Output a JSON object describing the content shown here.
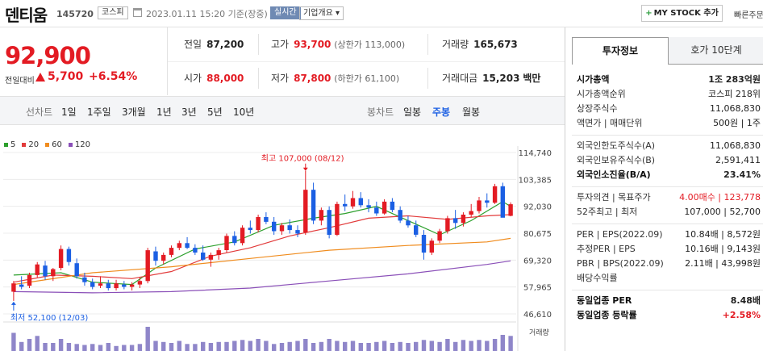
{
  "header": {
    "stock_name": "덴티움",
    "stock_code": "145720",
    "market": "코스피",
    "datetime": "2023.01.11 15:20 기준(장중)",
    "realtime_label": "실시간",
    "company_overview_label": "기업개요 ▾",
    "mystock_label": "MY STOCK 추가",
    "quick_order_label": "빠른주문"
  },
  "price": {
    "current": "92,900",
    "change_label": "전일대비",
    "change_value": "5,700",
    "change_pct": "+6.54%"
  },
  "summary": {
    "prev_close_label": "전일",
    "prev_close": "87,200",
    "high_label": "고가",
    "high": "93,700",
    "upper_limit": "(상한가 113,000)",
    "volume_label": "거래량",
    "volume": "165,673",
    "open_label": "시가",
    "open": "88,000",
    "low_label": "저가",
    "low": "87,800",
    "lower_limit": "(하한가 61,100)",
    "amount_label": "거래대금",
    "amount": "15,203",
    "amount_unit": "백만"
  },
  "period_bar": {
    "line_label": "선차트",
    "line_items": [
      "1일",
      "1주일",
      "3개월",
      "1년",
      "3년",
      "5년",
      "10년"
    ],
    "candle_label": "봉차트",
    "candle_items": [
      "일봉",
      "주봉",
      "월봉"
    ],
    "active_candle": "주봉"
  },
  "chart_data": {
    "type": "candlestick",
    "legend": [
      {
        "name": "5",
        "color": "#2da02d"
      },
      {
        "name": "20",
        "color": "#e23b3b"
      },
      {
        "name": "60",
        "color": "#f08c1e"
      },
      {
        "name": "120",
        "color": "#8a4fb8"
      }
    ],
    "y_ticks": [
      "114,740",
      "103,385",
      "92,030",
      "80,675",
      "69,320",
      "57,965",
      "46,610"
    ],
    "ylim": [
      46610,
      114740
    ],
    "max_annotation": "최고 107,000 (08/12)",
    "min_annotation": "최저 52,100 (12/03)",
    "volume_label": "거래량",
    "up_color": "#e31b23",
    "down_color": "#1b5fe3",
    "candles": [
      {
        "o": 56000,
        "h": 60500,
        "l": 52100,
        "c": 59500
      },
      {
        "o": 59000,
        "h": 62500,
        "l": 57000,
        "c": 58000
      },
      {
        "o": 58500,
        "h": 64000,
        "l": 57500,
        "c": 63000
      },
      {
        "o": 63000,
        "h": 68500,
        "l": 62000,
        "c": 67500
      },
      {
        "o": 67000,
        "h": 69000,
        "l": 61000,
        "c": 62500
      },
      {
        "o": 62500,
        "h": 66000,
        "l": 60500,
        "c": 65500
      },
      {
        "o": 66000,
        "h": 75500,
        "l": 65000,
        "c": 74000
      },
      {
        "o": 74000,
        "h": 75000,
        "l": 67000,
        "c": 68500
      },
      {
        "o": 68000,
        "h": 70000,
        "l": 61500,
        "c": 62500
      },
      {
        "o": 62000,
        "h": 64000,
        "l": 58500,
        "c": 60000
      },
      {
        "o": 60000,
        "h": 61500,
        "l": 57000,
        "c": 58000
      },
      {
        "o": 58500,
        "h": 62500,
        "l": 57500,
        "c": 59500
      },
      {
        "o": 59500,
        "h": 61000,
        "l": 56500,
        "c": 57500
      },
      {
        "o": 57500,
        "h": 61000,
        "l": 56500,
        "c": 59500
      },
      {
        "o": 59000,
        "h": 60500,
        "l": 57000,
        "c": 58000
      },
      {
        "o": 58000,
        "h": 60000,
        "l": 56500,
        "c": 59000
      },
      {
        "o": 59000,
        "h": 62000,
        "l": 57500,
        "c": 60500
      },
      {
        "o": 60500,
        "h": 74500,
        "l": 59500,
        "c": 73500
      },
      {
        "o": 73000,
        "h": 75000,
        "l": 67000,
        "c": 69000
      },
      {
        "o": 69000,
        "h": 72500,
        "l": 67500,
        "c": 71500
      },
      {
        "o": 71500,
        "h": 75500,
        "l": 70500,
        "c": 74500
      },
      {
        "o": 74500,
        "h": 77500,
        "l": 73500,
        "c": 76500
      },
      {
        "o": 76500,
        "h": 79000,
        "l": 74000,
        "c": 74500
      },
      {
        "o": 74500,
        "h": 76000,
        "l": 71500,
        "c": 72500
      },
      {
        "o": 72500,
        "h": 75500,
        "l": 69000,
        "c": 69500
      },
      {
        "o": 69500,
        "h": 72500,
        "l": 66500,
        "c": 71500
      },
      {
        "o": 71500,
        "h": 74500,
        "l": 69500,
        "c": 73500
      },
      {
        "o": 73500,
        "h": 80500,
        "l": 72500,
        "c": 79500
      },
      {
        "o": 79500,
        "h": 81500,
        "l": 75500,
        "c": 76500
      },
      {
        "o": 76500,
        "h": 84000,
        "l": 75500,
        "c": 83000
      },
      {
        "o": 83000,
        "h": 86000,
        "l": 80500,
        "c": 82000
      },
      {
        "o": 82000,
        "h": 88500,
        "l": 81000,
        "c": 87500
      },
      {
        "o": 87500,
        "h": 89500,
        "l": 84500,
        "c": 85500
      },
      {
        "o": 85500,
        "h": 87500,
        "l": 80000,
        "c": 81500
      },
      {
        "o": 81500,
        "h": 85000,
        "l": 80000,
        "c": 84000
      },
      {
        "o": 84000,
        "h": 86500,
        "l": 80500,
        "c": 82000
      },
      {
        "o": 82000,
        "h": 84000,
        "l": 79000,
        "c": 80500
      },
      {
        "o": 81000,
        "h": 107000,
        "l": 80000,
        "c": 99000
      },
      {
        "o": 99000,
        "h": 102000,
        "l": 84500,
        "c": 86000
      },
      {
        "o": 86000,
        "h": 91500,
        "l": 84000,
        "c": 90500
      },
      {
        "o": 90500,
        "h": 92000,
        "l": 78500,
        "c": 80000
      },
      {
        "o": 80000,
        "h": 94000,
        "l": 79500,
        "c": 93000
      },
      {
        "o": 93000,
        "h": 97000,
        "l": 90000,
        "c": 92000
      },
      {
        "o": 92000,
        "h": 98500,
        "l": 91000,
        "c": 95500
      },
      {
        "o": 95500,
        "h": 98000,
        "l": 91500,
        "c": 92500
      },
      {
        "o": 92500,
        "h": 95000,
        "l": 89500,
        "c": 91500
      },
      {
        "o": 91500,
        "h": 94000,
        "l": 88000,
        "c": 89000
      },
      {
        "o": 89000,
        "h": 95000,
        "l": 88500,
        "c": 94000
      },
      {
        "o": 94000,
        "h": 95500,
        "l": 89500,
        "c": 90500
      },
      {
        "o": 90500,
        "h": 92000,
        "l": 85000,
        "c": 86000
      },
      {
        "o": 86000,
        "h": 88000,
        "l": 83000,
        "c": 84000
      },
      {
        "o": 84000,
        "h": 86000,
        "l": 79000,
        "c": 80000
      },
      {
        "o": 80000,
        "h": 82000,
        "l": 69500,
        "c": 72500
      },
      {
        "o": 72500,
        "h": 78500,
        "l": 71500,
        "c": 77500
      },
      {
        "o": 77500,
        "h": 82500,
        "l": 76500,
        "c": 81500
      },
      {
        "o": 81500,
        "h": 88000,
        "l": 80500,
        "c": 87000
      },
      {
        "o": 87000,
        "h": 90500,
        "l": 82500,
        "c": 85000
      },
      {
        "o": 85000,
        "h": 89500,
        "l": 83500,
        "c": 88500
      },
      {
        "o": 88500,
        "h": 93000,
        "l": 87500,
        "c": 90000
      },
      {
        "o": 90000,
        "h": 96000,
        "l": 89000,
        "c": 94500
      },
      {
        "o": 94500,
        "h": 97500,
        "l": 91500,
        "c": 93500
      },
      {
        "o": 93500,
        "h": 101500,
        "l": 93000,
        "c": 100500
      },
      {
        "o": 100500,
        "h": 102000,
        "l": 88000,
        "c": 87200
      },
      {
        "o": 88000,
        "h": 93700,
        "l": 87800,
        "c": 92900
      }
    ],
    "volumes": [
      18,
      9,
      12,
      15,
      8,
      8,
      12,
      8,
      7,
      6,
      7,
      6,
      8,
      5,
      6,
      6,
      7,
      24,
      10,
      9,
      8,
      10,
      7,
      7,
      9,
      8,
      9,
      9,
      10,
      11,
      10,
      12,
      10,
      7,
      8,
      9,
      10,
      12,
      8,
      9,
      12,
      10,
      9,
      10,
      8,
      8,
      9,
      10,
      8,
      9,
      8,
      9,
      11,
      10,
      9,
      12,
      9,
      11,
      10,
      11,
      10,
      12,
      16,
      15
    ],
    "ma": {
      "5": [
        [
          0,
          63000
        ],
        [
          6,
          64000
        ],
        [
          10,
          60000
        ],
        [
          15,
          59000
        ],
        [
          18,
          66000
        ],
        [
          23,
          74000
        ],
        [
          28,
          77000
        ],
        [
          33,
          84000
        ],
        [
          38,
          87000
        ],
        [
          42,
          89000
        ],
        [
          46,
          92000
        ],
        [
          50,
          86000
        ],
        [
          54,
          80000
        ],
        [
          58,
          86000
        ],
        [
          62,
          94000
        ],
        [
          63,
          92000
        ]
      ],
      "20": [
        [
          0,
          60000
        ],
        [
          5,
          63000
        ],
        [
          10,
          62500
        ],
        [
          15,
          61500
        ],
        [
          20,
          64500
        ],
        [
          25,
          71000
        ],
        [
          30,
          74500
        ],
        [
          35,
          79500
        ],
        [
          40,
          83000
        ],
        [
          45,
          87000
        ],
        [
          50,
          88000
        ],
        [
          55,
          86500
        ],
        [
          60,
          88000
        ],
        [
          63,
          88500
        ]
      ],
      "60": [
        [
          0,
          59000
        ],
        [
          10,
          64000
        ],
        [
          20,
          66500
        ],
        [
          30,
          70000
        ],
        [
          40,
          73500
        ],
        [
          50,
          75500
        ],
        [
          60,
          77000
        ],
        [
          63,
          78500
        ]
      ],
      "120": [
        [
          0,
          56000
        ],
        [
          10,
          55500
        ],
        [
          20,
          56000
        ],
        [
          30,
          57500
        ],
        [
          40,
          60500
        ],
        [
          50,
          63500
        ],
        [
          60,
          67500
        ],
        [
          63,
          69000
        ]
      ]
    }
  },
  "right_panel": {
    "tab_invest": "투자정보",
    "tab_orderbook": "호가 10단계",
    "rows": [
      {
        "k": "시가총액",
        "v": "1조 283억원",
        "kb": true,
        "vb": true
      },
      {
        "k": "시가총액순위",
        "v": "코스피 218위"
      },
      {
        "k": "상장주식수",
        "v": "11,068,830"
      },
      {
        "k": "액면가 | 매매단위",
        "v": "500원 | 1주"
      },
      {
        "gap": true
      },
      {
        "k": "외국인한도주식수(A)",
        "v": "11,068,830"
      },
      {
        "k": "외국인보유주식수(B)",
        "v": "2,591,411"
      },
      {
        "k": "외국인소진율(B/A)",
        "v": "23.41%",
        "kb": true,
        "vb": true
      },
      {
        "gap": true
      },
      {
        "k": "투자의견 | 목표주가",
        "v": "4.00매수 | 123,778",
        "vred": true
      },
      {
        "k": "52주최고 | 최저",
        "v": "107,000 | 52,700"
      },
      {
        "gap": true
      },
      {
        "k": "PER | EPS(2022.09)",
        "v": "10.84배 | 8,572원"
      },
      {
        "k": "추정PER | EPS",
        "v": "10.16배 | 9,143원"
      },
      {
        "k": "PBR | BPS(2022.09)",
        "v": "2.11배 | 43,998원"
      },
      {
        "k": "배당수익률",
        "v": ""
      },
      {
        "gap": true
      },
      {
        "k": "동일업종 PER",
        "v": "8.48배",
        "kb": true,
        "vb": true
      },
      {
        "k": "동일업종 등락률",
        "v": "+2.58%",
        "kb": true,
        "vredb": true
      }
    ]
  }
}
